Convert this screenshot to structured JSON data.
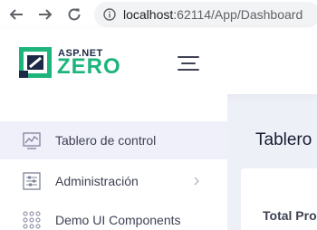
{
  "browser": {
    "url_host": "localhost",
    "url_path": ":62114/App/Dashboard"
  },
  "header": {
    "logo_top": "ASP.NET",
    "logo_bottom": "ZERO"
  },
  "sidebar": {
    "items": [
      {
        "label": "Tablero de control",
        "icon": "chart-icon",
        "active": true
      },
      {
        "label": "Administración",
        "icon": "settings-sliders-icon",
        "has_submenu": true
      },
      {
        "label": "Demo UI Components",
        "icon": "grid-dots-icon"
      }
    ]
  },
  "main": {
    "page_title": "Tablero",
    "card_title": "Total Pro"
  },
  "colors": {
    "brand_green": "#1db57c",
    "brand_navy": "#1c2a48",
    "active_bg": "#f0f0fb",
    "page_bg": "#eef0f8"
  }
}
